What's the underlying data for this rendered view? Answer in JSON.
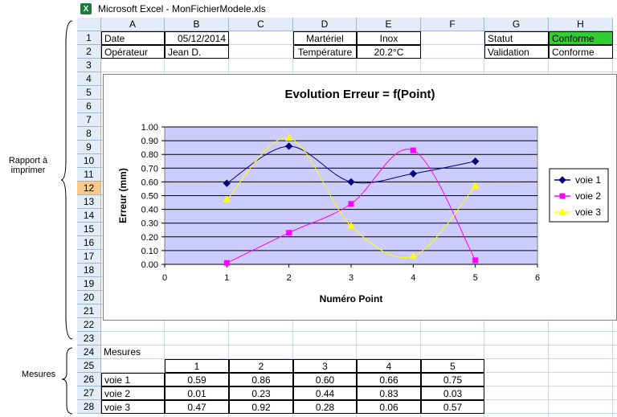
{
  "window": {
    "title": "Microsoft Excel - MonFichierModele.xls",
    "icon": "excel-icon"
  },
  "columns": [
    "A",
    "B",
    "C",
    "D",
    "E",
    "F",
    "G",
    "H"
  ],
  "rows": [
    "1",
    "2",
    "3",
    "4",
    "5",
    "6",
    "7",
    "8",
    "9",
    "10",
    "11",
    "12",
    "13",
    "14",
    "15",
    "16",
    "17",
    "18",
    "19",
    "20",
    "21",
    "22",
    "23",
    "24",
    "25",
    "26",
    "27",
    "28"
  ],
  "selected_row": "12",
  "side_labels": {
    "report": "Rapport à imprimer",
    "measures": "Mesures"
  },
  "header_cells": {
    "date_label": "Date",
    "date_value": "05/12/2014",
    "operator_label": "Opérateur",
    "operator_value": "Jean D.",
    "material_label": "Martériel",
    "material_value": "Inox",
    "temperature_label": "Température",
    "temperature_value": "20.2°C",
    "status_label": "Statut",
    "status_value": "Conforme",
    "validation_label": "Validation",
    "validation_value": "Conforme"
  },
  "colors": {
    "status_ok": "#33cc33",
    "plot_bg": "#ccccff",
    "voie1": "#000080",
    "voie2": "#ff00ff",
    "voie3": "#ffff00"
  },
  "measures": {
    "title": "Mesures",
    "points": [
      "1",
      "2",
      "3",
      "4",
      "5"
    ],
    "rows": [
      {
        "label": "voie 1",
        "values": [
          "0.59",
          "0.86",
          "0.60",
          "0.66",
          "0.75"
        ]
      },
      {
        "label": "voie 2",
        "values": [
          "0.01",
          "0.23",
          "0.44",
          "0.83",
          "0.03"
        ]
      },
      {
        "label": "voie 3",
        "values": [
          "0.47",
          "0.92",
          "0.28",
          "0.06",
          "0.57"
        ]
      }
    ]
  },
  "chart_data": {
    "type": "line",
    "title": "Evolution Erreur = f(Point)",
    "xlabel": "Numéro Point",
    "ylabel": "Erreur (mm)",
    "xlim": [
      0,
      6
    ],
    "ylim": [
      0,
      1
    ],
    "x_ticks": [
      "0",
      "1",
      "2",
      "3",
      "4",
      "5",
      "6"
    ],
    "y_ticks": [
      "0.00",
      "0.10",
      "0.20",
      "0.30",
      "0.40",
      "0.50",
      "0.60",
      "0.70",
      "0.80",
      "0.90",
      "1.00"
    ],
    "legend_position": "right",
    "grid": true,
    "smooth": true,
    "x": [
      1,
      2,
      3,
      4,
      5
    ],
    "series": [
      {
        "name": "voie 1",
        "values": [
          0.59,
          0.86,
          0.6,
          0.66,
          0.75
        ],
        "color": "#000080",
        "marker": "diamond"
      },
      {
        "name": "voie 2",
        "values": [
          0.01,
          0.23,
          0.44,
          0.83,
          0.03
        ],
        "color": "#ff00ff",
        "marker": "square"
      },
      {
        "name": "voie 3",
        "values": [
          0.47,
          0.92,
          0.28,
          0.06,
          0.57
        ],
        "color": "#ffff00",
        "marker": "triangle"
      }
    ]
  }
}
